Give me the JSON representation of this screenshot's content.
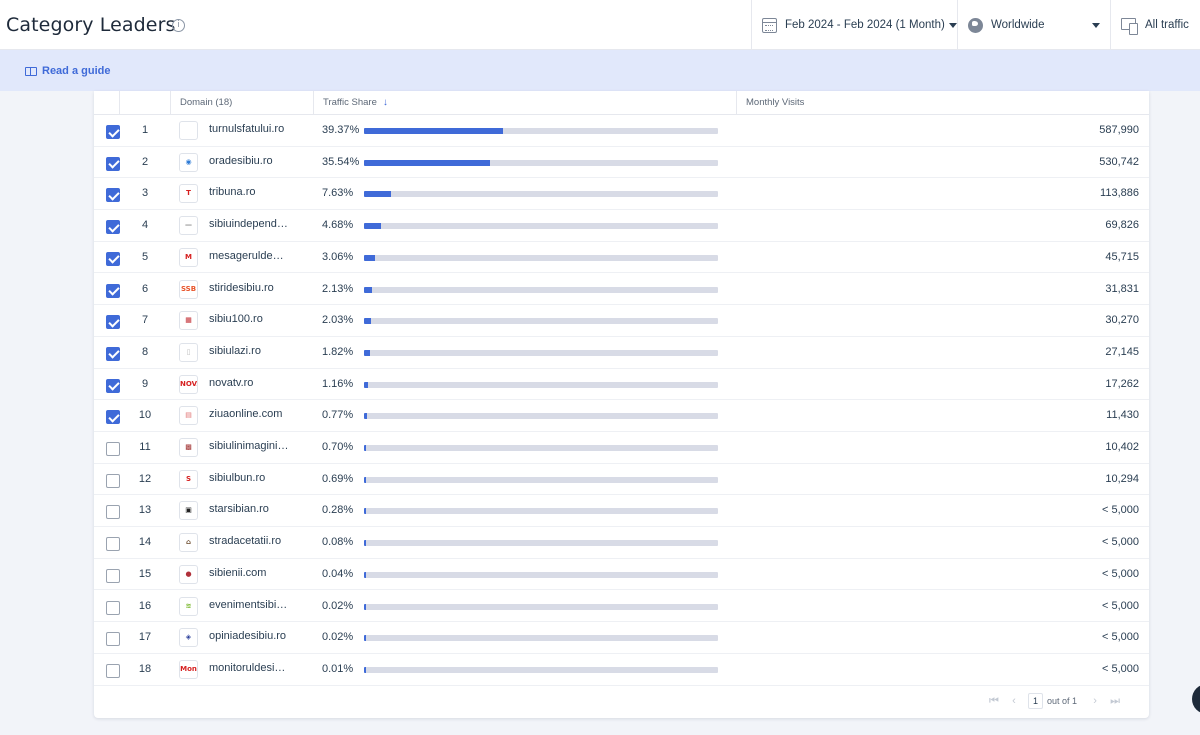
{
  "header": {
    "title": "Category Leaders",
    "info_icon": "info-icon",
    "date_filter": "Feb 2024 - Feb 2024 (1 Month)",
    "geo_filter": "Worldwide",
    "traffic_filter": "All traffic"
  },
  "guide": {
    "label": "Read a guide"
  },
  "table": {
    "columns": {
      "domain": "Domain (18)",
      "share": "Traffic Share",
      "visits": "Monthly Visits"
    },
    "rows": [
      {
        "rank": "1",
        "domain": "turnulsfatului.ro",
        "share": "39.37%",
        "share_value": 39.37,
        "visits": "587,990",
        "checked": true,
        "fav": "",
        "fav_color": "#333"
      },
      {
        "rank": "2",
        "domain": "oradesibiu.ro",
        "share": "35.54%",
        "share_value": 35.54,
        "visits": "530,742",
        "checked": true,
        "fav": "◉",
        "fav_color": "#2e7bd6"
      },
      {
        "rank": "3",
        "domain": "tribuna.ro",
        "share": "7.63%",
        "share_value": 7.63,
        "visits": "113,886",
        "checked": true,
        "fav": "T",
        "fav_color": "#d62020"
      },
      {
        "rank": "4",
        "domain": "sibiuindependent.ro",
        "share": "4.68%",
        "share_value": 4.68,
        "visits": "69,826",
        "checked": true,
        "fav": "—",
        "fav_color": "#888"
      },
      {
        "rank": "5",
        "domain": "mesageruldesibiu.ro",
        "share": "3.06%",
        "share_value": 3.06,
        "visits": "45,715",
        "checked": true,
        "fav": "M",
        "fav_color": "#d62020"
      },
      {
        "rank": "6",
        "domain": "stiridesibiu.ro",
        "share": "2.13%",
        "share_value": 2.13,
        "visits": "31,831",
        "checked": true,
        "fav": "SSB",
        "fav_color": "#e8542a"
      },
      {
        "rank": "7",
        "domain": "sibiu100.ro",
        "share": "2.03%",
        "share_value": 2.03,
        "visits": "30,270",
        "checked": true,
        "fav": "▦",
        "fav_color": "#c0282e"
      },
      {
        "rank": "8",
        "domain": "sibiulazi.ro",
        "share": "1.82%",
        "share_value": 1.82,
        "visits": "27,145",
        "checked": true,
        "fav": "▯",
        "fav_color": "#bbb"
      },
      {
        "rank": "9",
        "domain": "novatv.ro",
        "share": "1.16%",
        "share_value": 1.16,
        "visits": "17,262",
        "checked": true,
        "fav": "NOVA",
        "fav_color": "#d62020"
      },
      {
        "rank": "10",
        "domain": "ziuaonline.com",
        "share": "0.77%",
        "share_value": 0.77,
        "visits": "11,430",
        "checked": true,
        "fav": "▤",
        "fav_color": "#e07070"
      },
      {
        "rank": "11",
        "domain": "sibiulinimagini.ro",
        "share": "0.70%",
        "share_value": 0.7,
        "visits": "10,402",
        "checked": false,
        "fav": "▩",
        "fav_color": "#a03030"
      },
      {
        "rank": "12",
        "domain": "sibiulbun.ro",
        "share": "0.69%",
        "share_value": 0.69,
        "visits": "10,294",
        "checked": false,
        "fav": "S",
        "fav_color": "#d62020"
      },
      {
        "rank": "13",
        "domain": "starsibian.ro",
        "share": "0.28%",
        "share_value": 0.28,
        "visits": "< 5,000",
        "checked": false,
        "fav": "▣",
        "fav_color": "#222"
      },
      {
        "rank": "14",
        "domain": "stradacetatii.ro",
        "share": "0.08%",
        "share_value": 0.08,
        "visits": "< 5,000",
        "checked": false,
        "fav": "⌂",
        "fav_color": "#6b4a2b"
      },
      {
        "rank": "15",
        "domain": "sibienii.com",
        "share": "0.04%",
        "share_value": 0.04,
        "visits": "< 5,000",
        "checked": false,
        "fav": "●",
        "fav_color": "#b0303a"
      },
      {
        "rank": "16",
        "domain": "evenimentsibian.ro",
        "share": "0.02%",
        "share_value": 0.02,
        "visits": "< 5,000",
        "checked": false,
        "fav": "≋",
        "fav_color": "#7ab82e"
      },
      {
        "rank": "17",
        "domain": "opiniadesibiu.ro",
        "share": "0.02%",
        "share_value": 0.02,
        "visits": "< 5,000",
        "checked": false,
        "fav": "◈",
        "fav_color": "#2a3e9a"
      },
      {
        "rank": "18",
        "domain": "monitoruldesibiu.ro",
        "share": "0.01%",
        "share_value": 0.01,
        "visits": "< 5,000",
        "checked": false,
        "fav": "Mon",
        "fav_color": "#d62020"
      }
    ]
  },
  "pagination": {
    "page": "1",
    "of_label": "out of 1"
  },
  "colors": {
    "accent": "#3f6ad8",
    "track": "#d8dbe6",
    "guide_bg": "#e1e8fb"
  }
}
